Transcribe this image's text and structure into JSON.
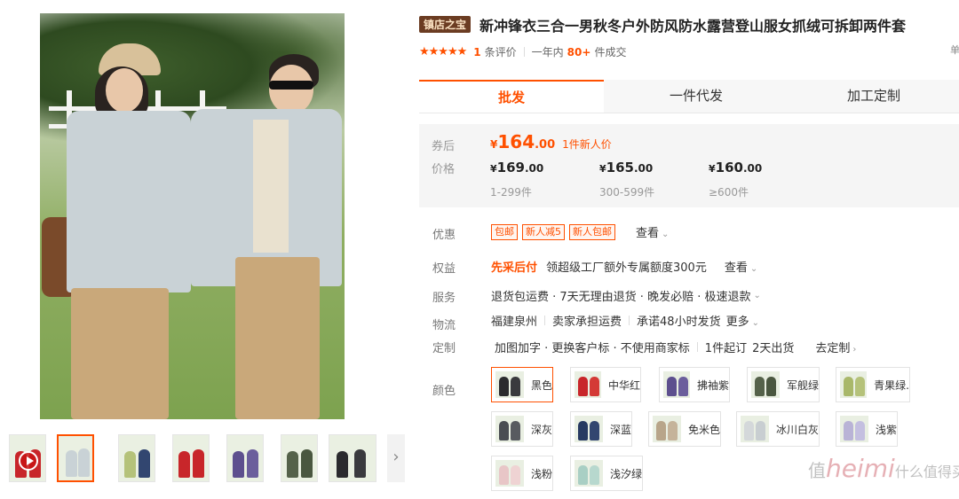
{
  "product": {
    "badge": "镇店之宝",
    "title": "新冲锋衣三合一男秋冬户外防风防水露营登山服女抓绒可拆卸两件套",
    "title_overflow": "单",
    "stars": "★★★★★",
    "review_count": "1",
    "review_label": "条评价",
    "sales_prefix": "一年内",
    "sales_count": "80+",
    "sales_suffix": "件成交"
  },
  "tabs": [
    {
      "label": "批发",
      "active": true
    },
    {
      "label": "一件代发",
      "active": false
    },
    {
      "label": "加工定制",
      "active": false
    }
  ],
  "price": {
    "coupon_label": "券后",
    "price_label": "价格",
    "coupon_yen": "¥",
    "coupon_int": "164",
    "coupon_dec": ".00",
    "coupon_note": "1件新人价",
    "tiers": [
      {
        "yen": "¥",
        "int": "169",
        "dec": ".00",
        "qty": "1-299件"
      },
      {
        "yen": "¥",
        "int": "165",
        "dec": ".00",
        "qty": "300-599件"
      },
      {
        "yen": "¥",
        "int": "160",
        "dec": ".00",
        "qty": "≥600件"
      }
    ]
  },
  "rows": {
    "discount": {
      "label": "优惠",
      "tags": [
        "包邮",
        "新人减5",
        "新人包邮"
      ],
      "link": "查看"
    },
    "rights": {
      "label": "权益",
      "highlight": "先采后付",
      "text": "领超级工厂额外专属额度300元",
      "link": "查看"
    },
    "service": {
      "label": "服务",
      "text": "退货包运费 · 7天无理由退货 · 晚发必赔 · 极速退款"
    },
    "logistics": {
      "label": "物流",
      "origin": "福建泉州",
      "freight": "卖家承担运费",
      "ship": "承诺48小时发货",
      "more": "更多"
    },
    "custom": {
      "label": "定制",
      "text": "加图加字 · 更换客户标 · 不使用商家标",
      "moq": "1件起订",
      "lead": "2天出货",
      "link": "去定制"
    },
    "color": {
      "label": "颜色"
    }
  },
  "colors": [
    {
      "name": "黑色",
      "c1": "#2b2b2e",
      "c2": "#3a3a3e",
      "selected": true
    },
    {
      "name": "中华红",
      "c1": "#c8262a",
      "c2": "#d43a36",
      "selected": false
    },
    {
      "name": "拂袖紫",
      "c1": "#5d4f8e",
      "c2": "#6b5e9c",
      "selected": false
    },
    {
      "name": "军舰绿",
      "c1": "#55624a",
      "c2": "#4a5740",
      "selected": false
    },
    {
      "name": "青果绿.",
      "c1": "#a9b86a",
      "c2": "#b5c27a",
      "selected": false
    },
    {
      "name": "深灰",
      "c1": "#4a4d52",
      "c2": "#585b60",
      "selected": false
    },
    {
      "name": "深蓝",
      "c1": "#283b62",
      "c2": "#324670",
      "selected": false
    },
    {
      "name": "免米色",
      "c1": "#b8a58a",
      "c2": "#c5b39a",
      "selected": false
    },
    {
      "name": "冰川白灰",
      "c1": "#d4d8da",
      "c2": "#c8ced1",
      "selected": false
    },
    {
      "name": "浅紫",
      "c1": "#b9b3d6",
      "c2": "#c4bfe0",
      "selected": false
    },
    {
      "name": "浅粉",
      "c1": "#e8c6c7",
      "c2": "#efd3d3",
      "selected": false
    },
    {
      "name": "浅汐绿",
      "c1": "#a9cfc4",
      "c2": "#b7d8ce",
      "selected": false
    }
  ],
  "watermark": {
    "main": "值",
    "script": "heimi",
    "text": "什么值得买"
  }
}
